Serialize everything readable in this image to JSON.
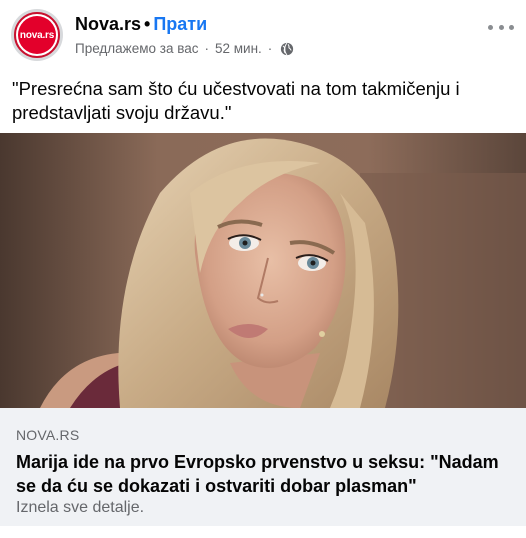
{
  "header": {
    "avatar_text": "nova.rs",
    "page_name": "Nova.rs",
    "separator": "•",
    "follow_label": "Прати",
    "meta_label": "Предлажемо за вас",
    "meta_sep": "·",
    "time": "52 мин.",
    "meta_sep2": "·",
    "audience_icon": "globe-icon",
    "more_icon": "more-options-icon"
  },
  "post": {
    "caption": "\"Presrećna sam što ću učestvovati na tom takmičenju i predstavljati svoju državu.\""
  },
  "link_preview": {
    "domain": "NOVA.RS",
    "title": "Marija ide na prvo Evropsko prvenstvo u seksu: \"Nadam se da ću se dokazati i ostvariti dobar plasman\"",
    "description": "Iznela sve detalje."
  },
  "colors": {
    "brand_red": "#e3002b",
    "link_blue": "#1877f2",
    "meta_gray": "#65676b",
    "preview_bg": "#f0f2f5"
  }
}
